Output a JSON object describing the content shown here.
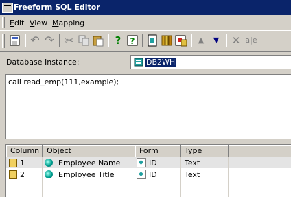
{
  "window": {
    "title": "Freeform SQL Editor",
    "icon": "sql-editor-icon"
  },
  "menu": [
    {
      "label_ul": "E",
      "label_rest": "dit"
    },
    {
      "label_ul": "V",
      "label_rest": "iew"
    },
    {
      "label_ul": "M",
      "label_rest": "apping"
    }
  ],
  "toolbar": {
    "icons": [
      "save",
      "undo",
      "redo",
      "cut",
      "copy",
      "paste",
      "help",
      "context-help",
      "insert-prompt",
      "library",
      "object-browser",
      "move-up",
      "move-down",
      "delete",
      "rename"
    ],
    "glyphs": {
      "undo": "↶",
      "redo": "↷",
      "cut": "✂",
      "help": "?",
      "move-up": "▲",
      "move-down": "▼",
      "delete": "✕",
      "rename": "a|e"
    }
  },
  "database": {
    "label": "Database Instance:",
    "value": "DB2WH"
  },
  "sql": {
    "text": "call read_emp(111,example);"
  },
  "grid": {
    "columns": [
      "Column",
      "Object",
      "Form",
      "Type"
    ],
    "rows": [
      {
        "column": "1",
        "object": "Employee Name",
        "form": "ID",
        "type": "Text",
        "selected": true
      },
      {
        "column": "2",
        "object": "Employee Title",
        "form": "ID",
        "type": "Text",
        "selected": false
      }
    ]
  },
  "colors": {
    "titlebar": "#0a246a",
    "face": "#d4d0c8",
    "highlight": "#0a246a"
  }
}
